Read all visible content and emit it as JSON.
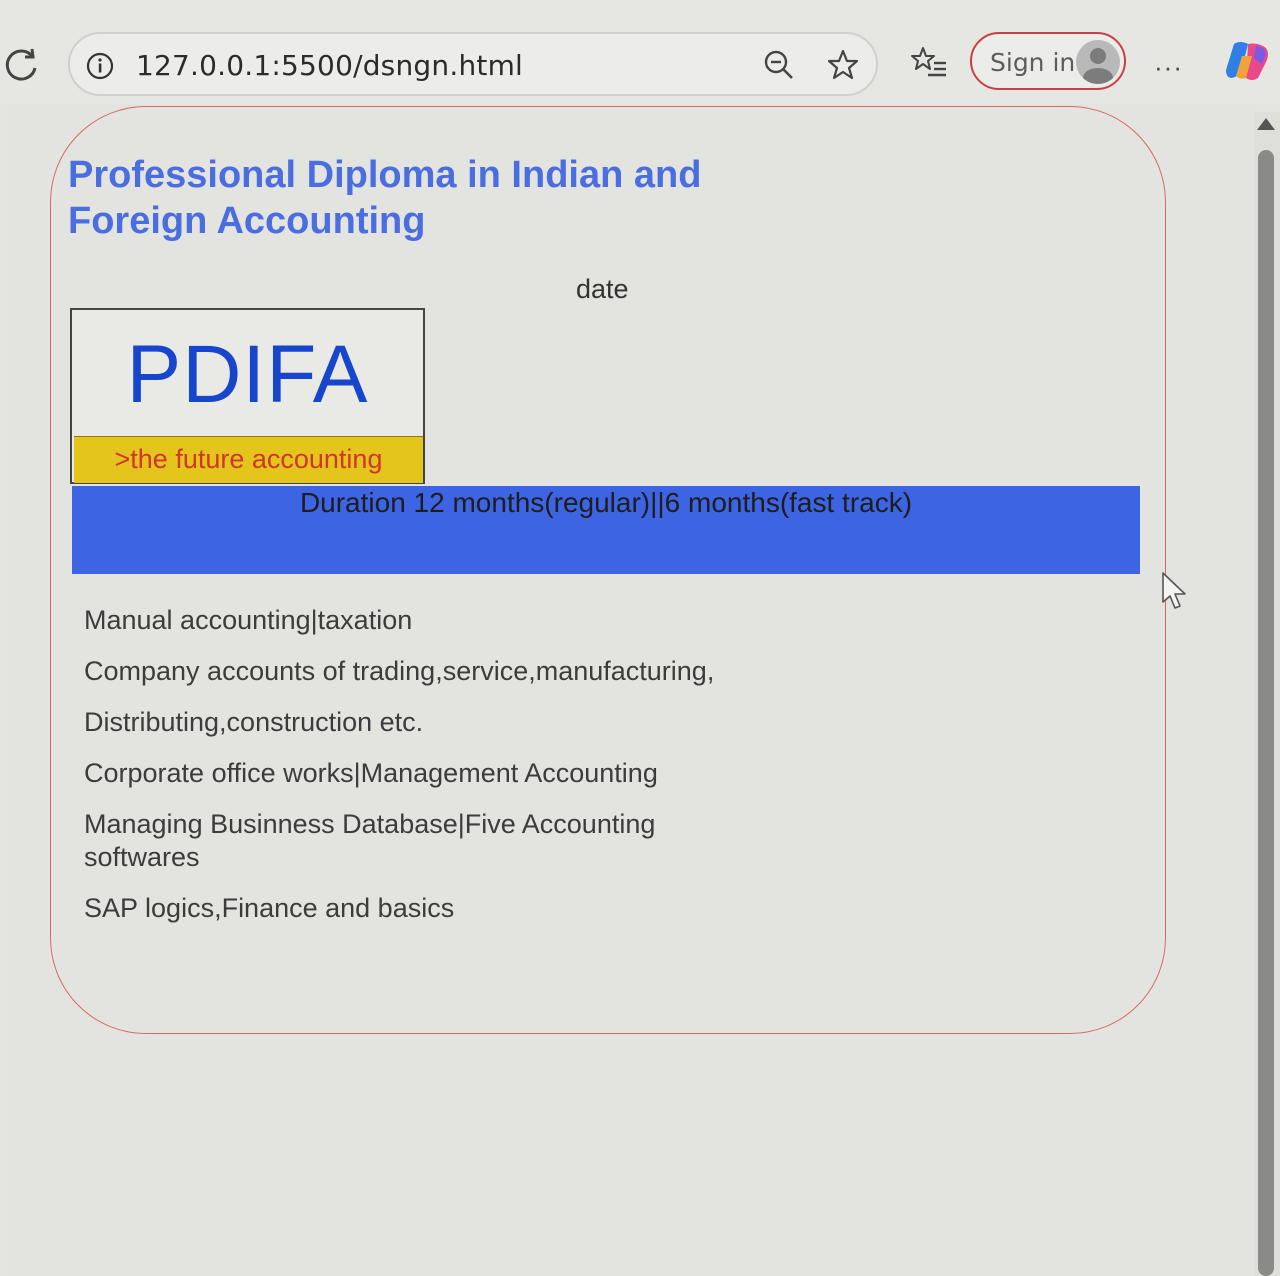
{
  "browser": {
    "url": "127.0.0.1:5500/dsngn.html",
    "sign_in_label": "Sign in",
    "more_label": "···"
  },
  "page": {
    "title": "Professional Diploma in Indian and Foreign Accounting",
    "date_label": "date",
    "logo": {
      "text": "PDIFA",
      "tagline": ">the future accounting"
    },
    "duration": "Duration 12 months(regular)||6 months(fast track)",
    "features": [
      "Manual accounting|taxation",
      "Company accounts of trading,service,manufacturing,",
      "Distributing,construction etc.",
      "Corporate office works|Management Accounting",
      "Managing Businness Database|Five Accounting softwares",
      "SAP logics,Finance and basics"
    ]
  },
  "colors": {
    "heading": "#4a6ee0",
    "logo_text": "#1746cc",
    "tagline_bg": "#e3c51c",
    "tagline_text": "#d0362a",
    "duration_bg": "#3d64e3",
    "card_border": "#d66a61"
  }
}
